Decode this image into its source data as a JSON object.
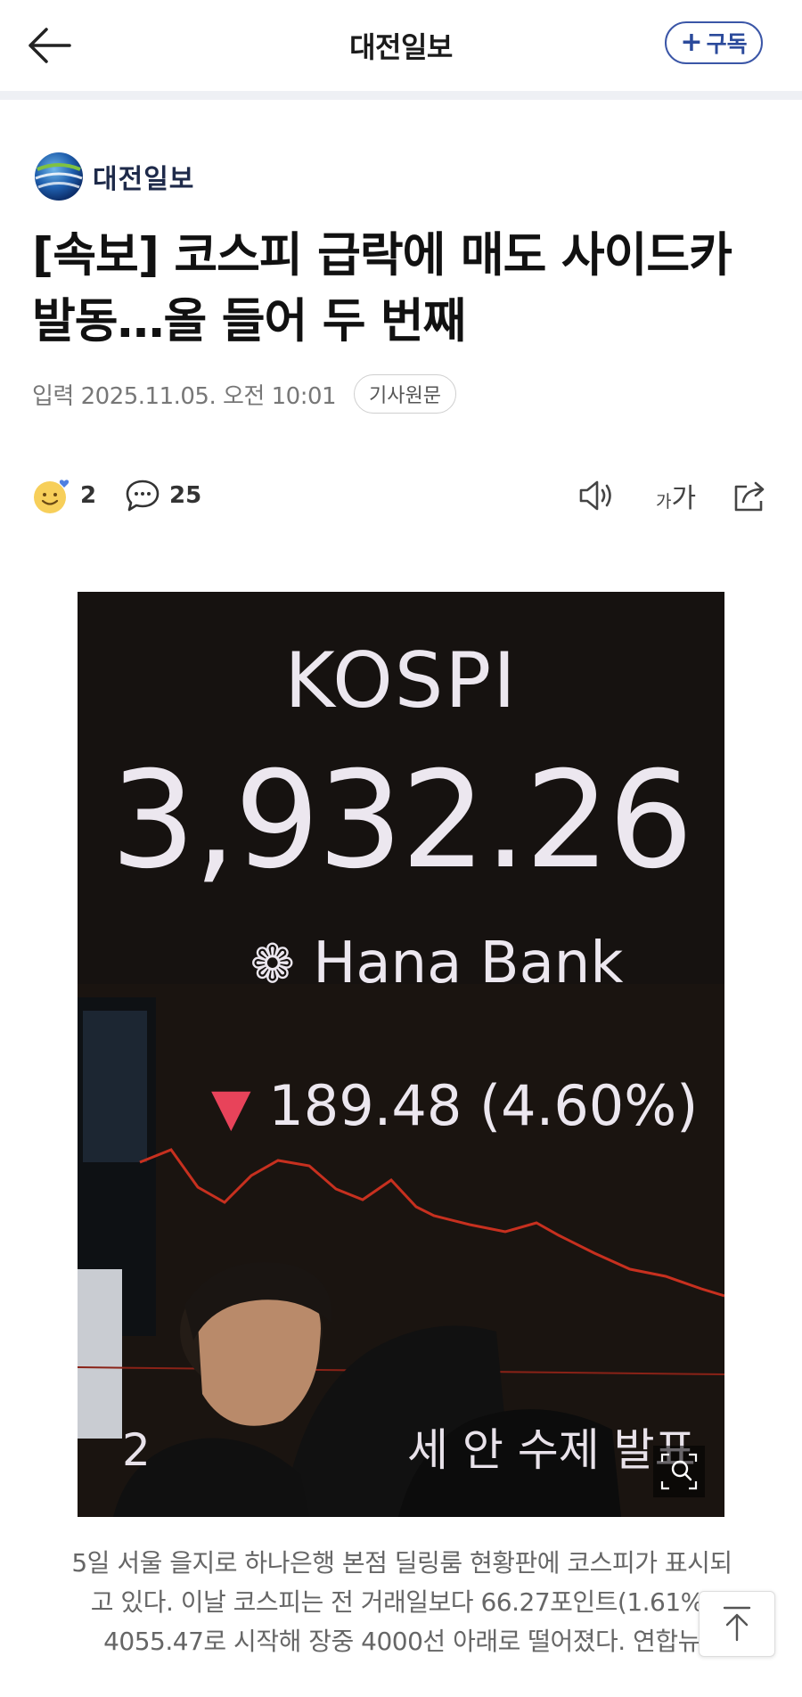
{
  "header": {
    "title": "대전일보",
    "subscribe_label": "구독",
    "subscribe_plus": "+"
  },
  "press": {
    "name": "대전일보"
  },
  "article": {
    "headline_line1": "[속보] 코스피 급락에 매도 사이드카",
    "headline_line2": "발동…올 들어 두 번째",
    "date": "입력 2025.11.05. 오전 10:01",
    "original_label": "기사원문"
  },
  "actions": {
    "reaction_count": "2",
    "comment_count": "25",
    "font_size_small": "가",
    "font_size_large": "가"
  },
  "photo": {
    "board_title": "KOSPI",
    "index_value": "3,932.26",
    "bank_name": "Hana Bank",
    "change_text": "189.48 (4.60%)",
    "bottom_text": "2 세   안 수제 발표",
    "line_color": "#c7301f",
    "down_color": "#e8435a"
  },
  "caption": {
    "line1": "5일 서울 을지로 하나은행 본점 딜링룸 현황판에 코스피가 표시되",
    "line2": "고 있다. 이날 코스피는 전 거래일보다 66.27포인트(1.61%)",
    "line3": "4055.47로 시작해 장중 4000선 아래로 떨어졌다. 연합뉴"
  }
}
